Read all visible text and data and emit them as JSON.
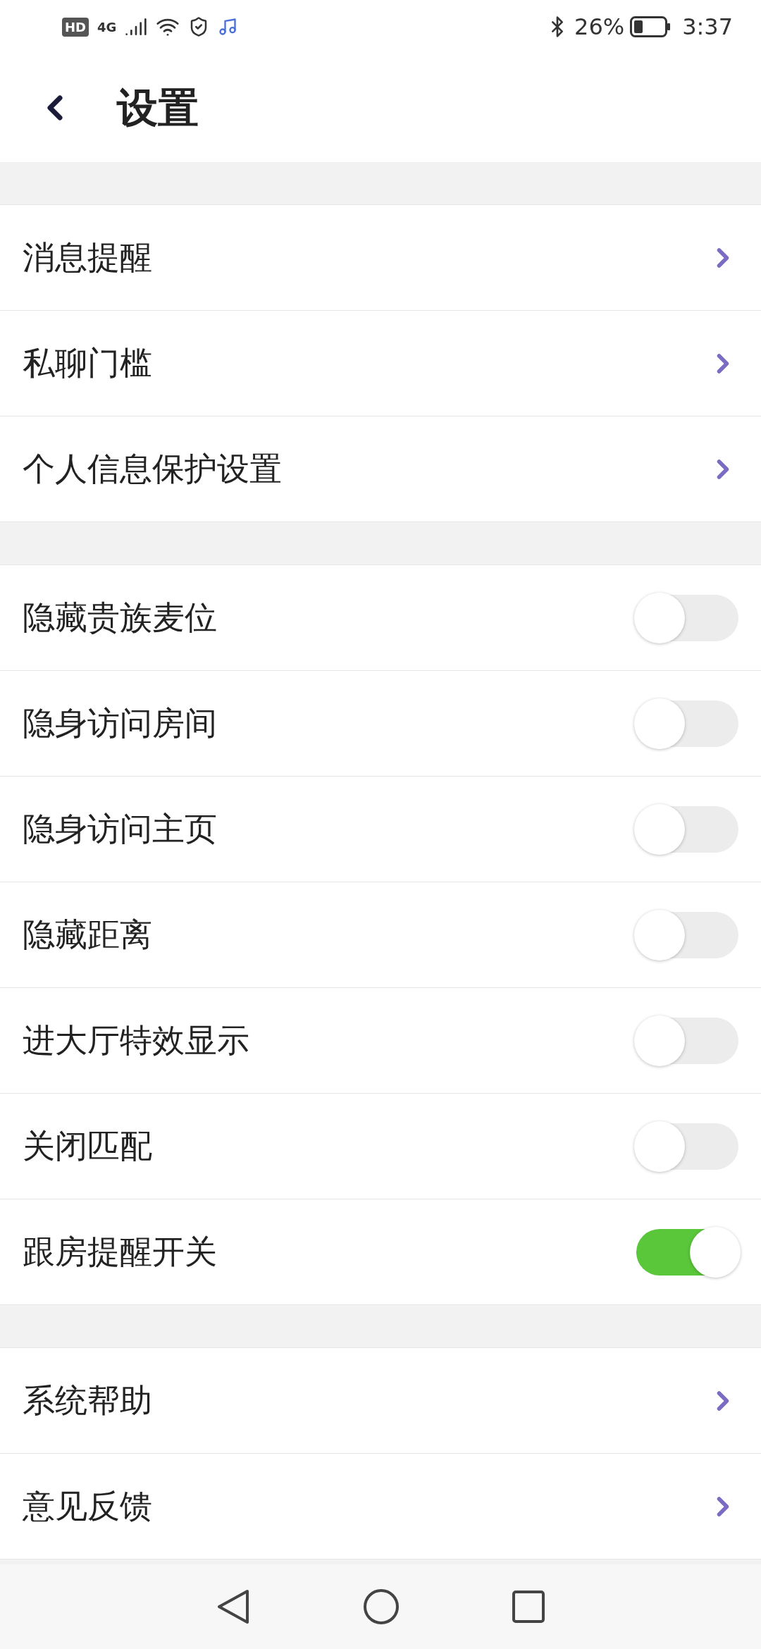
{
  "status_bar": {
    "badges": [
      "HD",
      "4G"
    ],
    "battery": "26%",
    "time": "3:37"
  },
  "header": {
    "title": "设置"
  },
  "sections": [
    {
      "items": [
        {
          "kind": "link",
          "label": "消息提醒"
        },
        {
          "kind": "link",
          "label": "私聊门槛"
        },
        {
          "kind": "link",
          "label": "个人信息保护设置"
        }
      ]
    },
    {
      "items": [
        {
          "kind": "toggle",
          "label": "隐藏贵族麦位",
          "on": false
        },
        {
          "kind": "toggle",
          "label": "隐身访问房间",
          "on": false
        },
        {
          "kind": "toggle",
          "label": "隐身访问主页",
          "on": false
        },
        {
          "kind": "toggle",
          "label": "隐藏距离",
          "on": false
        },
        {
          "kind": "toggle",
          "label": "进大厅特效显示",
          "on": false
        },
        {
          "kind": "toggle",
          "label": "关闭匹配",
          "on": false
        },
        {
          "kind": "toggle",
          "label": "跟房提醒开关",
          "on": true
        }
      ]
    },
    {
      "items": [
        {
          "kind": "link",
          "label": "系统帮助"
        },
        {
          "kind": "link",
          "label": "意见反馈"
        }
      ]
    }
  ]
}
